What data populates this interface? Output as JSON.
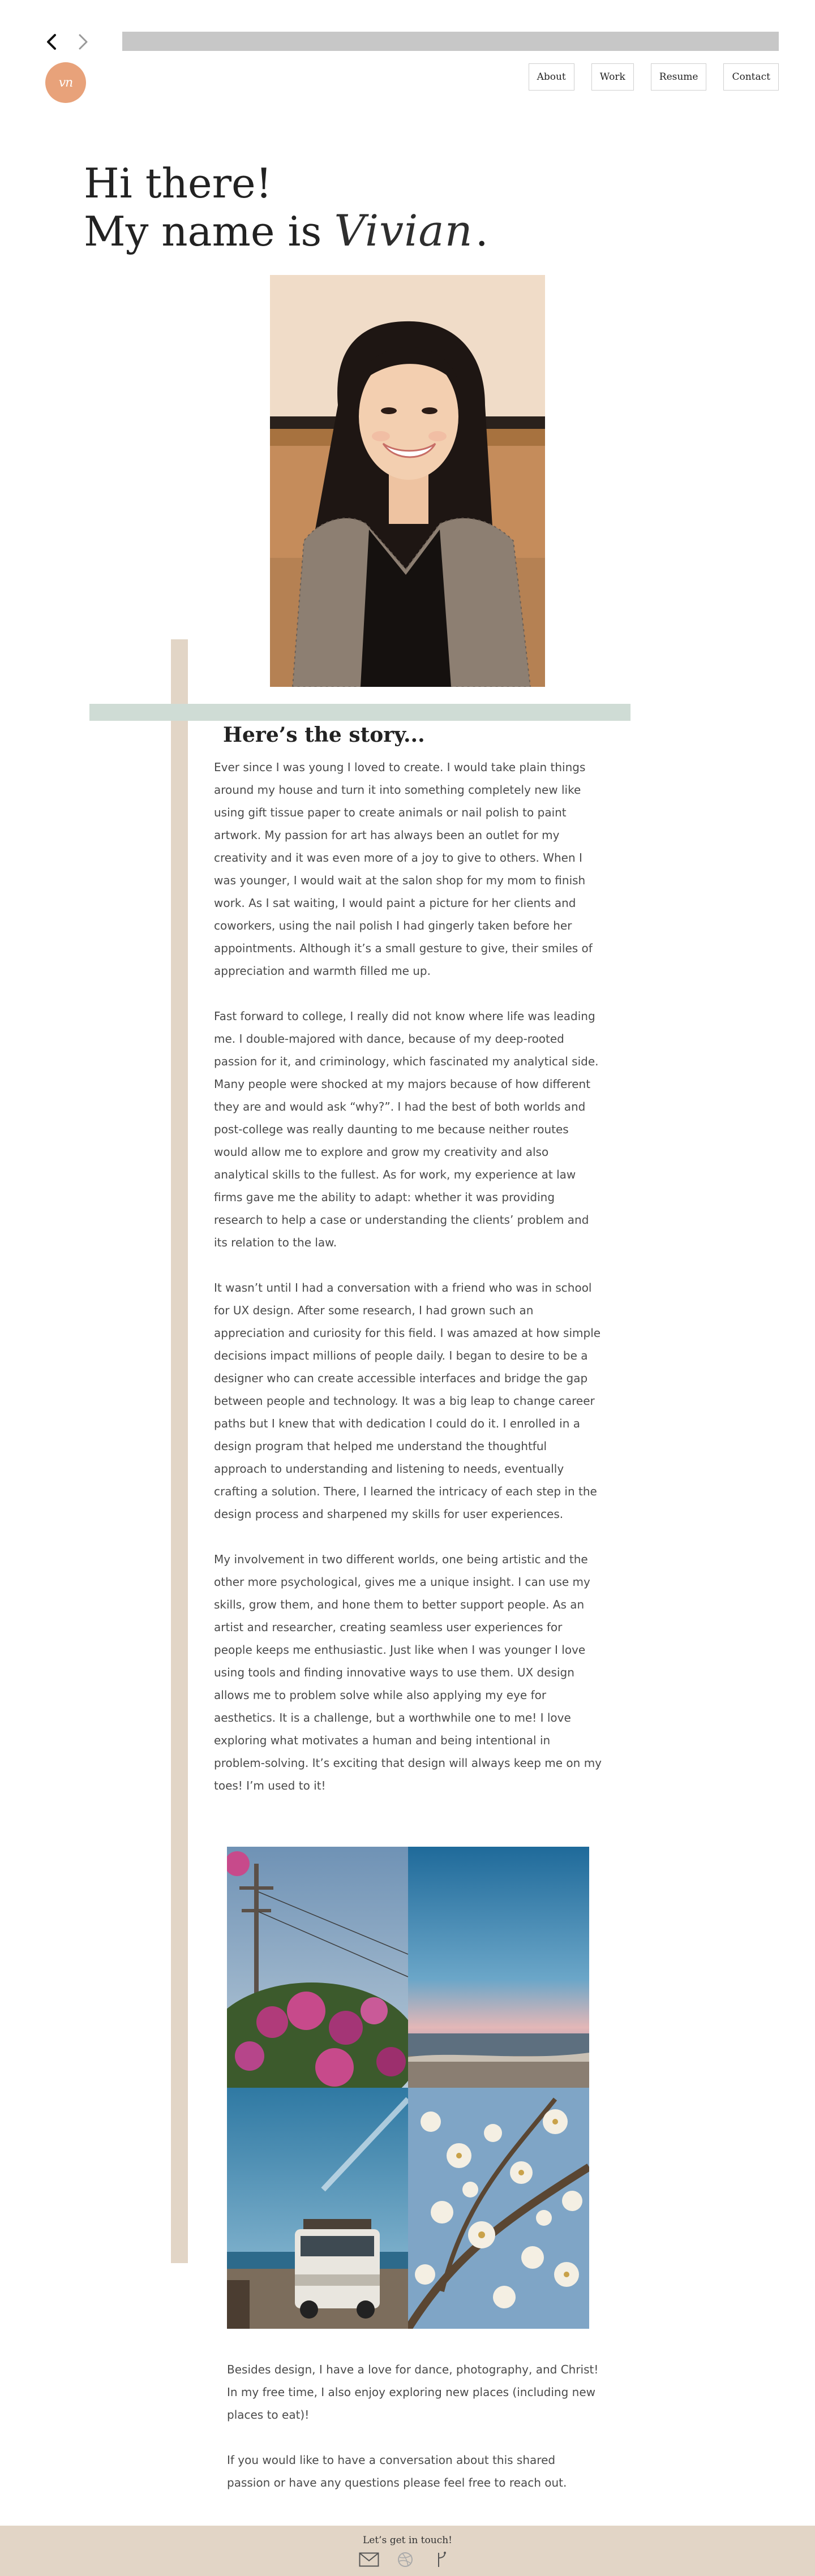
{
  "browser": {
    "back_icon": "chevron-left-icon",
    "forward_icon": "chevron-right-icon"
  },
  "header": {
    "logo_text": "vn",
    "logo_color": "#e8a27a",
    "nav": [
      {
        "label": "About"
      },
      {
        "label": "Work"
      },
      {
        "label": "Resume"
      },
      {
        "label": "Contact"
      }
    ]
  },
  "hero": {
    "line1": "Hi there!",
    "line2_prefix": "My name is",
    "name": "Vivian",
    "suffix": "."
  },
  "story": {
    "title": "Here’s the story...",
    "paragraphs": [
      "Ever since I was young I loved to create. I would take plain things around my house and turn it into something completely new like using gift tissue paper to create animals or nail polish to paint artwork. My passion for art has always been an outlet for my creativity and it was even more of a joy to give to others. When I was younger, I would wait at the salon shop for my mom to finish work. As I sat waiting, I would paint a picture for her clients and coworkers, using the nail polish I had gingerly taken before her appointments. Although it’s a small gesture to give, their smiles of appreciation and warmth filled me up.",
      "Fast forward to college, I really did not know where life was leading me. I double-majored with dance, because of my deep-rooted passion for it, and criminology, which fascinated my analytical side. Many people were shocked at my majors because of how different they are and would ask “why?”. I had the best of both worlds and post-college was really daunting to me because neither routes would allow me to explore and grow my creativity and also analytical skills to the fullest. As for work, my experience at law firms gave me the ability to adapt: whether it was providing research to help a case or understanding the clients’ problem and its relation to the law.",
      "It wasn’t until I had a conversation with a friend who was in school for UX design. After some research, I had grown such an appreciation and curiosity for this field. I was amazed at how simple decisions impact millions of people daily. I began to desire to be a designer who can create accessible interfaces and bridge the gap between people and technology. It was a big leap to change career paths but I knew that with dedication I could do it. I enrolled in a design program that helped me understand the thoughtful approach to understanding and listening to needs, eventually crafting a solution. There, I learned the intricacy of each step in the design process and sharpened my skills for user experiences.",
      " My involvement in two different worlds, one being artistic and the other more psychological, gives me a unique insight. I can use my skills, grow them, and hone them to better support people. As an artist and researcher, creating seamless user experiences for people keeps me enthusiastic. Just like when I was younger I love using tools and finding innovative ways to use them. UX design allows me to problem solve while also applying my eye for aesthetics. It is a challenge, but a worthwhile one to me! I love exploring what motivates a human and being intentional in problem-solving. It’s exciting that design will always keep me on my toes! I’m used to it!"
    ]
  },
  "outro": {
    "paragraphs": [
      "Besides design, I have a love for dance, photography, and Christ! In my free time, I also enjoy exploring new places (including new places to eat)!",
      "If you would like to have a conversation about this shared passion or have any questions please feel free to reach out."
    ]
  },
  "footer": {
    "title": "Let’s get in touch!",
    "icons": [
      "mail-icon",
      "dribbble-icon",
      "figma-icon"
    ],
    "background": "#e2d5c6"
  },
  "colors": {
    "vertical_bar": "#e2d5c6",
    "horizontal_bar": "#cfdcd5"
  }
}
